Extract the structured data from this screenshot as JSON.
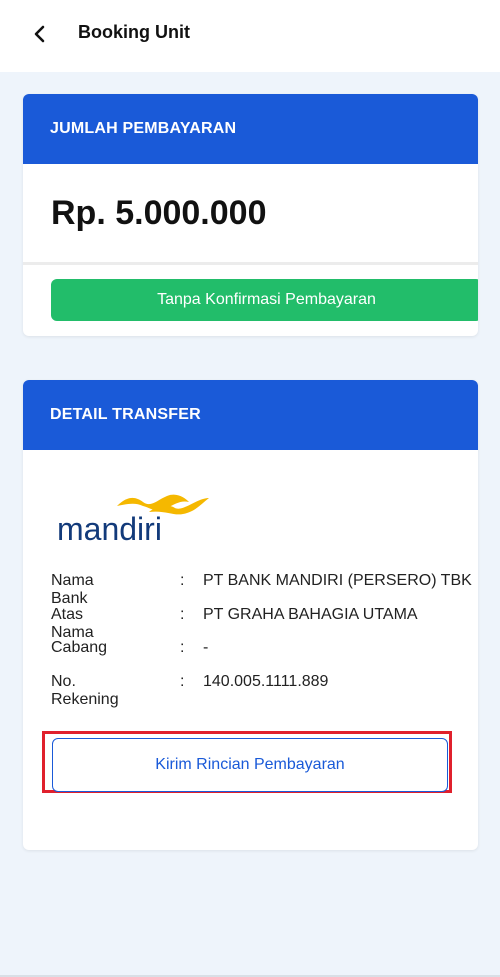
{
  "appbar": {
    "title": "Booking Unit"
  },
  "payment": {
    "header": "JUMLAH PEMBAYARAN",
    "amount": "Rp. 5.000.000",
    "no_confirm_label": "Tanpa Konfirmasi Pembayaran"
  },
  "transfer": {
    "header": "DETAIL TRANSFER",
    "logo_text": "mandiri",
    "rows": [
      {
        "label": "Nama Bank",
        "sep": ":",
        "value": "PT BANK MANDIRI (PERSERO) TBK"
      },
      {
        "label": "Atas Nama",
        "sep": ":",
        "value": "PT GRAHA BAHAGIA UTAMA"
      },
      {
        "label": "Cabang",
        "sep": ":",
        "value": "-"
      },
      {
        "label": "No. Rekening",
        "sep": ":",
        "value": "140.005.1111.889"
      }
    ],
    "send_details_label": "Kirim Rincian Pembayaran"
  },
  "colors": {
    "primary": "#1a5ad8",
    "success": "#22bd6a",
    "highlight": "#e0202c",
    "logo_gold": "#f5b800",
    "logo_navy": "#123a7a"
  },
  "icons": {
    "back": "chevron-left-icon"
  }
}
